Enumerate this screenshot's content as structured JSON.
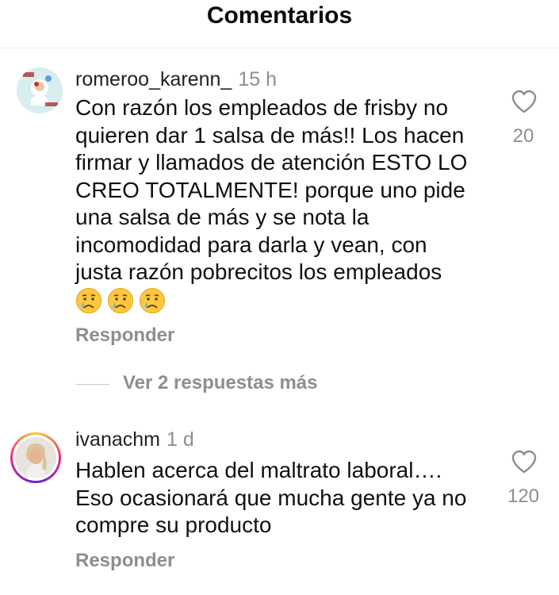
{
  "header": {
    "title": "Comentarios"
  },
  "comments": [
    {
      "username": "romeroo_karenn_",
      "time": "15 h",
      "text": "Con razón los empleados de frisby no\nquieren dar 1 salsa de más!! Los hacen\nfirmar y llamados de atención ESTO LO\nCREO TOTALMENTE! porque uno pide\nuna salsa de más y se nota la\nincomodidad para darla y vean, con\njusta razón pobrecitos los empleados",
      "emojis": [
        "crying-face",
        "crying-face",
        "crying-face"
      ],
      "likes": "20",
      "reply_label": "Responder"
    },
    {
      "username": "ivanachm",
      "time": "1 d",
      "text": "Hablen acerca del maltrato laboral….\nEso ocasionará que mucha gente ya no\ncompre su producto",
      "likes": "120",
      "reply_label": "Responder"
    }
  ],
  "more_replies": "Ver 2 respuestas más",
  "colors": {
    "secondary_text": "#8e8e8e",
    "story_ring": [
      "#f9ce34",
      "#ee2a7b",
      "#6228d7"
    ]
  }
}
